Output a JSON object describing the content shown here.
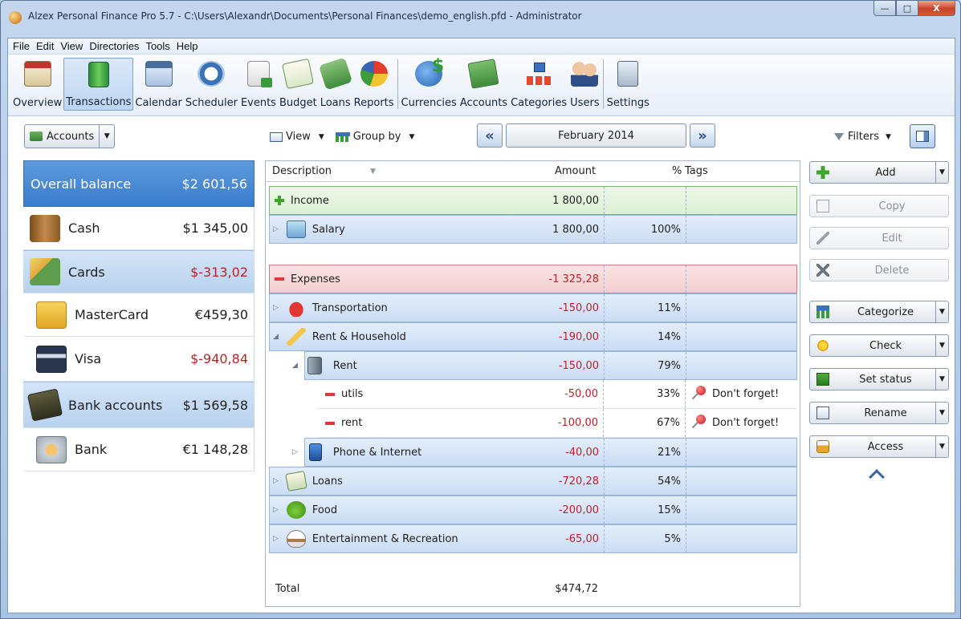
{
  "window": {
    "title": "Alzex Personal Finance Pro 5.7 - C:\\Users\\Alexandr\\Documents\\Personal Finances\\demo_english.pfd - Administrator",
    "minimize": "—",
    "maximize": "□",
    "close": "X"
  },
  "menu": [
    "File",
    "Edit",
    "View",
    "Directories",
    "Tools",
    "Help"
  ],
  "toolbar": {
    "items": [
      {
        "label": "Overview",
        "icon": "overview-icon"
      },
      {
        "label": "Transactions",
        "icon": "transactions-icon",
        "active": true
      },
      {
        "label": "Calendar",
        "icon": "calendar-icon"
      },
      {
        "label": "Scheduler",
        "icon": "scheduler-icon"
      },
      {
        "label": "Events",
        "icon": "events-icon"
      },
      {
        "label": "Budget",
        "icon": "budget-icon"
      },
      {
        "label": "Loans",
        "icon": "loans-icon"
      },
      {
        "label": "Reports",
        "icon": "reports-icon"
      },
      {
        "label": "Currencies",
        "icon": "currencies-icon"
      },
      {
        "label": "Accounts",
        "icon": "accounts-icon"
      },
      {
        "label": "Categories",
        "icon": "categories-icon"
      },
      {
        "label": "Users",
        "icon": "users-icon"
      },
      {
        "label": "Settings",
        "icon": "settings-icon"
      }
    ]
  },
  "subbar": {
    "accounts_label": "Accounts",
    "view_label": "View",
    "group_by_label": "Group by",
    "period": "February 2014",
    "prev": "«",
    "next": "»",
    "filters_label": "Filters"
  },
  "accounts": {
    "overall": {
      "name": "Overall balance",
      "value": "$2 601,56"
    },
    "rows": [
      {
        "name": "Cash",
        "value": "$1 345,00",
        "kind": "top"
      },
      {
        "name": "Cards",
        "value": "$-313,02",
        "kind": "group",
        "negative": true
      },
      {
        "name": "MasterCard",
        "value": "€459,30",
        "kind": "sub"
      },
      {
        "name": "Visa",
        "value": "$-940,84",
        "kind": "sub",
        "negative": true
      },
      {
        "name": "Bank accounts",
        "value": "$1 569,58",
        "kind": "group"
      },
      {
        "name": "Bank",
        "value": "€1 148,28",
        "kind": "sub"
      }
    ]
  },
  "table": {
    "headers": {
      "description": "Description",
      "amount": "Amount",
      "percent": "%",
      "tags": "Tags"
    },
    "income": {
      "label": "Income",
      "amount": "1 800,00"
    },
    "salary": {
      "label": "Salary",
      "amount": "1 800,00",
      "percent": "100%"
    },
    "expenses": {
      "label": "Expenses",
      "amount": "-1 325,28"
    },
    "categories": [
      {
        "label": "Transportation",
        "amount": "-150,00",
        "percent": "11%",
        "expander": "▷"
      },
      {
        "label": "Rent & Household",
        "amount": "-190,00",
        "percent": "14%",
        "expander": "◢"
      },
      {
        "label": "Rent",
        "amount": "-150,00",
        "percent": "79%",
        "expander": "◢"
      },
      {
        "label": "utils",
        "amount": "-50,00",
        "percent": "33%",
        "tag": "Don't forget!"
      },
      {
        "label": "rent",
        "amount": "-100,00",
        "percent": "67%",
        "tag": "Don't forget!"
      },
      {
        "label": "Phone & Internet",
        "amount": "-40,00",
        "percent": "21%",
        "expander": "▷"
      },
      {
        "label": "Loans",
        "amount": "-720,28",
        "percent": "54%",
        "expander": "▷"
      },
      {
        "label": "Food",
        "amount": "-200,00",
        "percent": "15%",
        "expander": "▷"
      },
      {
        "label": "Entertainment & Recreation",
        "amount": "-65,00",
        "percent": "5%",
        "expander": "▷"
      }
    ],
    "total": {
      "label": "Total",
      "amount": "$474,72"
    }
  },
  "actions": [
    {
      "label": "Add",
      "icon": "add-icon",
      "enabled": true,
      "dropdown": true
    },
    {
      "label": "Copy",
      "icon": "copy-icon",
      "enabled": false
    },
    {
      "label": "Edit",
      "icon": "edit-icon",
      "enabled": false
    },
    {
      "label": "Delete",
      "icon": "delete-icon",
      "enabled": false
    },
    {
      "label": "Categorize",
      "icon": "categorize-icon",
      "enabled": true,
      "dropdown": true
    },
    {
      "label": "Check",
      "icon": "check-star-icon",
      "enabled": true,
      "dropdown": true
    },
    {
      "label": "Set status",
      "icon": "status-icon",
      "enabled": true,
      "dropdown": true
    },
    {
      "label": "Rename",
      "icon": "rename-icon",
      "enabled": true,
      "dropdown": true
    },
    {
      "label": "Access",
      "icon": "lock-icon",
      "enabled": true,
      "dropdown": true
    }
  ],
  "colors": {
    "accent": "#3a7ccd",
    "negative": "#c0202a",
    "income_row": "#dcefd3",
    "expense_row": "#f3cfcf",
    "category_row": "#cadcf3"
  }
}
